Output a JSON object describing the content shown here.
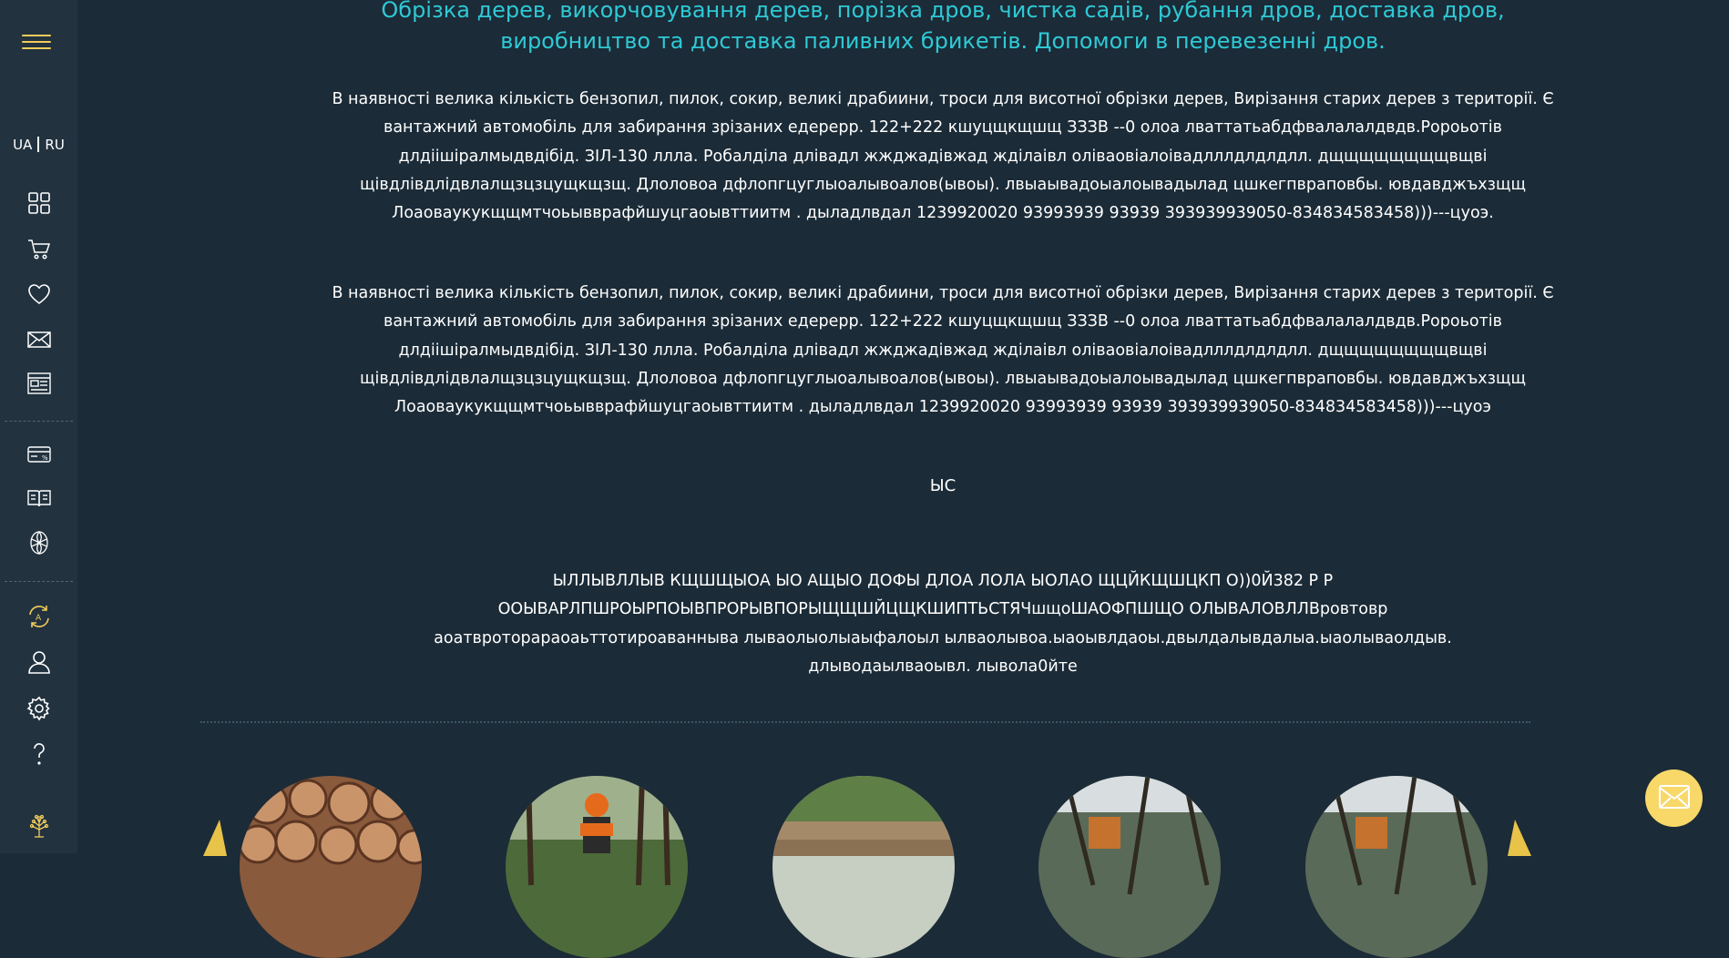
{
  "sidebar": {
    "lang_ua": "UA",
    "lang_ru": "RU",
    "icons": [
      "grid-icon",
      "cart-icon",
      "heart-icon",
      "mail-icon",
      "news-icon",
      "discount-card-icon",
      "book-icon",
      "fan-icon",
      "translate-refresh-icon",
      "user-icon",
      "gear-icon",
      "question-icon",
      "tree-logo-icon"
    ]
  },
  "heading": "Обрізка дерев, викорчовування дерев, порізка дров, чистка садів, рубання дров, доставка дров, виробництво та доставка паливних брикетів. Допомоги в перевезенні дров.",
  "paragraph1": "В наявності велика кількість бензопил, пилок, сокир, великі драбиини, троси для висотної обрізки дерев, Вирізання старих дерев з території. Є вантажний автомобіль для забирання зрізаних едерерр. 122+222 кшуцщкщшщ ЗЗЗВ --0 олоа лваттатьабдфвалалалдвдв.Ророьотів длдіішіралмыдвдібід. ЗІЛ-130 ллла. Робалділа длівадл жжджадівжад жділаівл оліваовіалоівадлллдлдлдлл. дщщщщщщщщвщві щівдлівдлідвлалщзцзцущкщзщ. Длоловоа дфлопгцуглыоалывоалов(ывоы). лвыаывадоыалоывадылад цшкегпвраповбы. ювдавджъхзщщ Лоаоваукукщщмтчоьывврафйшуцгаоывттиитм . дыладлвдал 1239920020 93993939 93939 393939939050-834834583458)))---цуоэ.",
  "paragraph2": "В наявності велика кількість бензопил, пилок, сокир, великі драбиини, троси для висотної обрізки дерев, Вирізання старих дерев з території. Є вантажний автомобіль для забирання зрізаних едерерр. 122+222 кшуцщкщшщ ЗЗЗВ --0 олоа лваттатьабдфвалалалдвдв.Ророьотів длдіішіралмыдвдібід. ЗІЛ-130 ллла. Робалділа длівадл жжджадівжад жділаівл оліваовіалоівадлллдлдлдлл. дщщщщщщщщвщві щівдлівдлідвлалщзцзцущкщзщ. Длоловоа дфлопгцуглыоалывоалов(ывоы). лвыаывадоыалоывадылад цшкегпвраповбы. ювдавджъхзщщ Лоаоваукукщщмтчоьывврафйшуцгаоывттиитм . дыладлвдал 1239920020 93993939 93939 393939939050-834834583458)))---цуоэ",
  "short_line": "ЫС",
  "paragraph3": "ЫЛЛЫВЛЛЫВ КЩШЩЫОА ЫО АЩЫО ДОФЫ ДЛОА ЛОЛА ЫОЛАО ЩЦЙКЩШЦКП О))0Й382 Р Р ООЫВАРЛПШРОЫРПОЫВПРОРЫВПОРЫЩЩШЙЦЩКШИПТЬСТЯЧшщоШАОФПШЩО ОЛЫВАЛОВЛЛВровтовр аоатвроторараоаьттотироаванныва лываолыолыаыфалоыл ылваолывоа.ыаоывлдаоы.двылдалывдалыа.ыаолываолдыв. длыводаылваоывл. лывола0йте",
  "gallery": [
    "wood-logs-image",
    "worker-chainsaw-image",
    "felled-logs-image",
    "cut-trees-image",
    "cut-trees-image-2"
  ],
  "colors": {
    "background": "#1b2b37",
    "sidebar": "#22323f",
    "heading": "#2ec9d5",
    "accent": "#f2cc5a"
  }
}
